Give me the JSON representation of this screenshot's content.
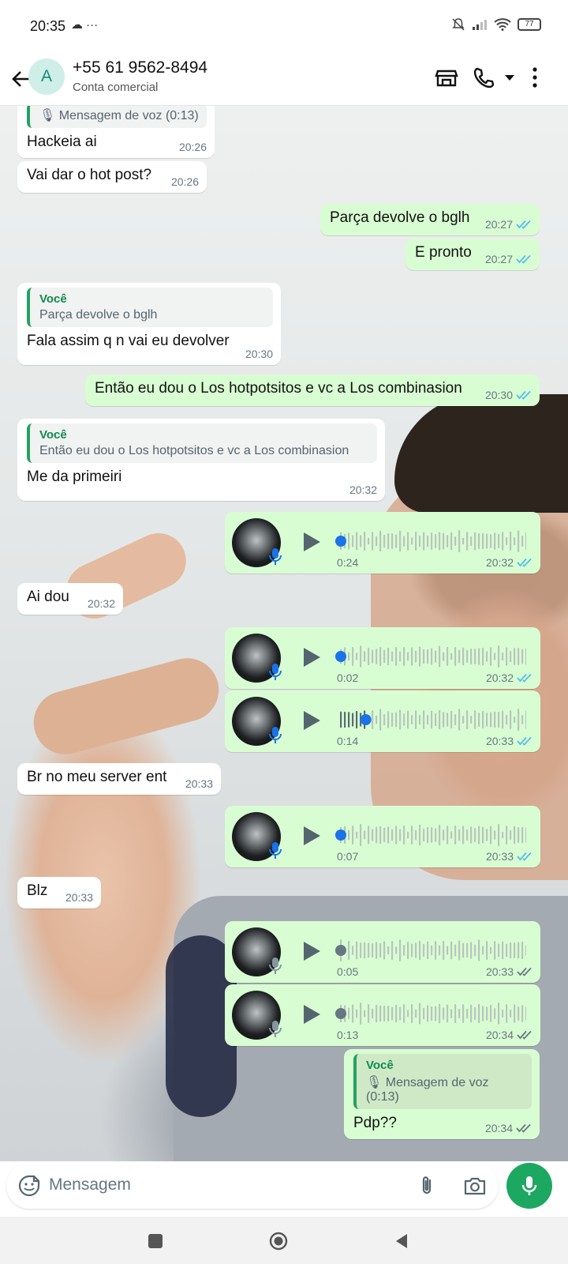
{
  "status_bar": {
    "time": "20:35",
    "icons_left": "☁ ···",
    "battery": "77"
  },
  "header": {
    "avatar_letter": "A",
    "contact_name": "+55 61 9562-8494",
    "contact_subtitle": "Conta comercial"
  },
  "messages": [
    {
      "kind": "text",
      "dir": "in",
      "quote": {
        "author": "",
        "text": "Mensagem de voz (0:13)"
      },
      "text": "Hackeia ai",
      "time": "20:26"
    },
    {
      "kind": "text",
      "dir": "in",
      "text": "Vai dar o hot post?",
      "time": "20:26"
    },
    {
      "kind": "text",
      "dir": "out",
      "text": "Parça devolve o bglh",
      "time": "20:27",
      "read": true
    },
    {
      "kind": "text",
      "dir": "out",
      "text": "E pronto",
      "time": "20:27",
      "read": true
    },
    {
      "kind": "text",
      "dir": "in",
      "quote": {
        "author": "Você",
        "text": "Parça devolve o bglh"
      },
      "text": "Fala assim q n vai eu devolver",
      "time": "20:30"
    },
    {
      "kind": "text",
      "dir": "out",
      "text": "Então eu dou o Los hotpotsitos e vc a Los combinasion",
      "time": "20:30",
      "read": true
    },
    {
      "kind": "text",
      "dir": "in",
      "quote": {
        "author": "Você",
        "text": "Então eu dou o Los hotpotsitos e vc a Los combinasion"
      },
      "text": "Me da primeiri",
      "time": "20:32"
    },
    {
      "kind": "voice",
      "dir": "out",
      "duration": "0:24",
      "time": "20:32",
      "read": true,
      "progress": 0,
      "played": true
    },
    {
      "kind": "text",
      "dir": "in",
      "text": "Ai dou",
      "time": "20:32"
    },
    {
      "kind": "voice",
      "dir": "out",
      "duration": "0:02",
      "time": "20:32",
      "read": true,
      "progress": 0,
      "played": true
    },
    {
      "kind": "voice",
      "dir": "out",
      "duration": "0:14",
      "time": "20:33",
      "read": true,
      "progress": 0.16,
      "played": true
    },
    {
      "kind": "text",
      "dir": "in",
      "text": "Br no meu server ent",
      "time": "20:33"
    },
    {
      "kind": "voice",
      "dir": "out",
      "duration": "0:07",
      "time": "20:33",
      "read": true,
      "progress": 0,
      "played": true
    },
    {
      "kind": "text",
      "dir": "in",
      "text": "Blz",
      "time": "20:33"
    },
    {
      "kind": "voice",
      "dir": "out",
      "duration": "0:05",
      "time": "20:33",
      "read": false,
      "progress": 0,
      "played": false
    },
    {
      "kind": "voice",
      "dir": "out",
      "duration": "0:13",
      "time": "20:34",
      "read": false,
      "progress": 0,
      "played": false
    },
    {
      "kind": "text",
      "dir": "out",
      "quote": {
        "author": "Você",
        "text": "Mensagem de voz (0:13)",
        "voice": true
      },
      "text": "Pdp??",
      "time": "20:34",
      "read": false
    }
  ],
  "input": {
    "placeholder": "Mensagem"
  },
  "colors": {
    "outgoing": "#d9fdd3",
    "incoming": "#ffffff",
    "accent": "#1da862",
    "read_tick": "#53bdeb",
    "progress_dot": "#1a73e8"
  },
  "icons": [
    "back-arrow-icon",
    "storefront-icon",
    "phone-icon",
    "dropdown-icon",
    "more-vert-icon",
    "mic-icon",
    "play-icon",
    "emoji-icon",
    "attach-icon",
    "camera-icon",
    "nav-square-icon",
    "nav-circle-icon",
    "nav-back-icon"
  ]
}
